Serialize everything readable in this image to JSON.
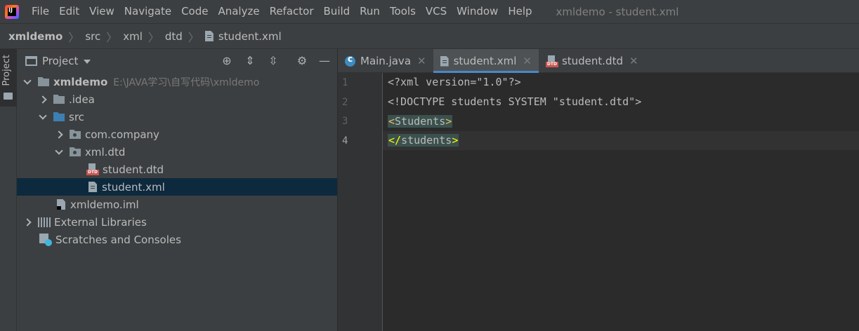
{
  "menu": {
    "items": [
      {
        "label": "File"
      },
      {
        "label": "Edit"
      },
      {
        "label": "View"
      },
      {
        "label": "Navigate"
      },
      {
        "label": "Code"
      },
      {
        "label": "Analyze"
      },
      {
        "label": "Refactor"
      },
      {
        "label": "Build"
      },
      {
        "label": "Run"
      },
      {
        "label": "Tools"
      },
      {
        "label": "VCS"
      },
      {
        "label": "Window"
      },
      {
        "label": "Help"
      }
    ],
    "window_title": "xmldemo - student.xml"
  },
  "breadcrumb": [
    "xmldemo",
    "src",
    "xml",
    "dtd",
    "student.xml"
  ],
  "stripe": {
    "project_label": "Project"
  },
  "project_panel": {
    "title": "Project",
    "tree": [
      {
        "label": "xmldemo",
        "hint": "E:\\JAVA学习\\自写代码\\xmldemo"
      },
      {
        "label": ".idea"
      },
      {
        "label": "src"
      },
      {
        "label": "com.company"
      },
      {
        "label": "xml.dtd"
      },
      {
        "label": "student.dtd"
      },
      {
        "label": "student.xml"
      },
      {
        "label": "xmldemo.iml"
      },
      {
        "label": "External Libraries"
      },
      {
        "label": "Scratches and Consoles"
      }
    ]
  },
  "tabs": [
    {
      "label": "Main.java"
    },
    {
      "label": "student.xml"
    },
    {
      "label": "student.dtd"
    }
  ],
  "editor": {
    "line_numbers": [
      "1",
      "2",
      "3",
      "4"
    ],
    "lines": [
      "<?xml version=\"1.0\"?>",
      "<!DOCTYPE students SYSTEM \"student.dtd\">",
      "<Students>",
      "</students>"
    ],
    "line3": {
      "open": "<",
      "name": "Students",
      "close": ">"
    },
    "line4": {
      "open": "</",
      "name": "students",
      "close": ">"
    }
  },
  "icons": {
    "dtd_tag": "DTD"
  },
  "colors": {
    "accent": "#4a88c7",
    "selection": "#0d293e",
    "tag_highlight": "#3b514d",
    "bracket_highlight": "#fefe00"
  }
}
